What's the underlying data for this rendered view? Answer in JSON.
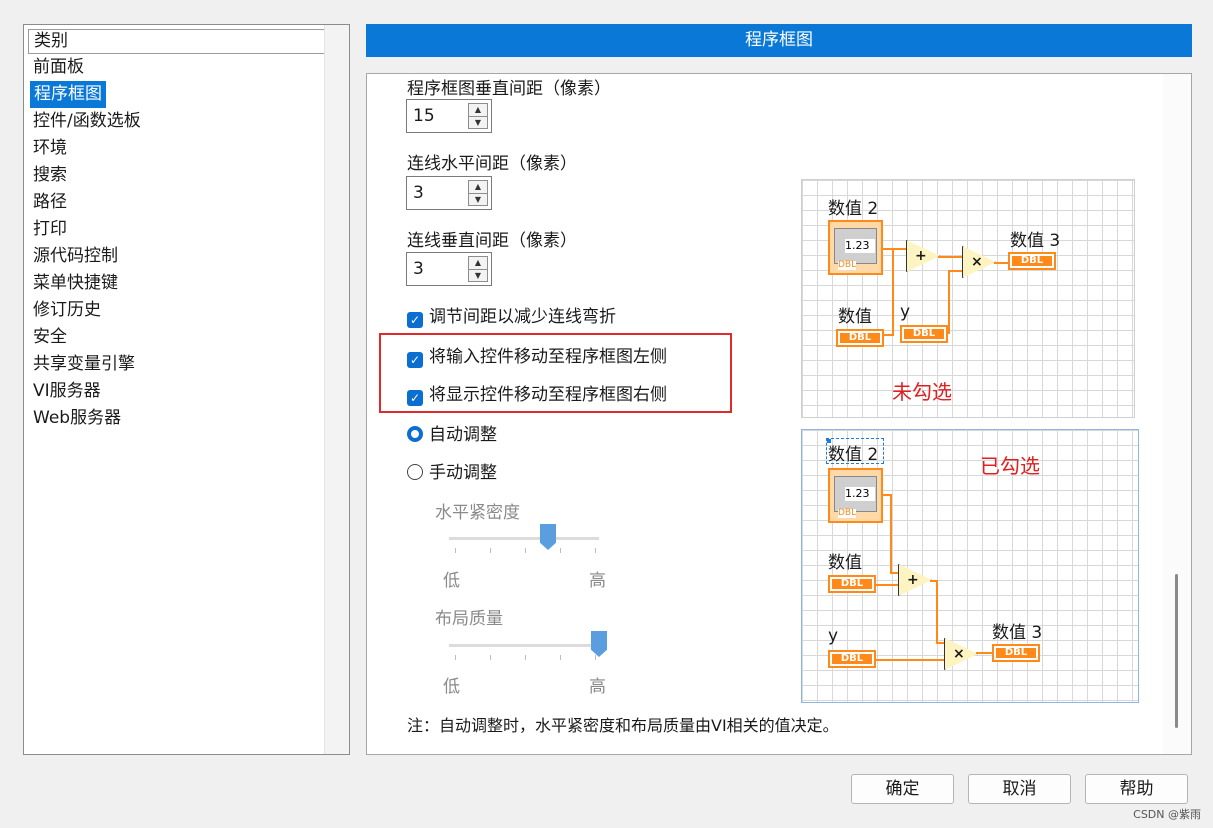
{
  "categories": {
    "header": "类别",
    "items": [
      "前面板",
      "程序框图",
      "控件/函数选板",
      "环境",
      "搜索",
      "路径",
      "打印",
      "源代码控制",
      "菜单快捷键",
      "修订历史",
      "安全",
      "共享变量引擎",
      "VI服务器",
      "Web服务器"
    ],
    "selected": "程序框图"
  },
  "panel_title": "程序框图",
  "settings": {
    "top_label": "程序框图垂直间距（像素）",
    "spin1_value": "15",
    "wire_h_label": "连线水平间距（像素）",
    "spin2_value": "3",
    "wire_v_label": "连线垂直间距（像素）",
    "spin3_value": "3",
    "adjust_spacing": {
      "label": "调节间距以减少连线弯折",
      "checked": true
    },
    "move_inputs_left": {
      "label": "将输入控件移动至程序框图左侧",
      "checked": true
    },
    "move_outputs_right": {
      "label": "将显示控件移动至程序框图右侧",
      "checked": true
    },
    "auto_adjust": {
      "label": "自动调整",
      "selected": true
    },
    "manual_adjust": {
      "label": "手动调整",
      "selected": false
    },
    "h_density": {
      "label": "水平紧密度",
      "low": "低",
      "high": "高",
      "value_fraction": 0.66
    },
    "layout_quality": {
      "label": "布局质量",
      "low": "低",
      "high": "高",
      "value_fraction": 1.0
    },
    "note": "注：自动调整时，水平紧密度和布局质量由VI相关的值决定。"
  },
  "diagrams": {
    "unchecked": {
      "caption": "未勾选",
      "num2": "数值 2",
      "num": "数值",
      "y": "y",
      "num3": "数值 3",
      "ctl_value": "1.23",
      "dbl": "DBL",
      "plus": "+",
      "times": "×"
    },
    "checked": {
      "caption": "已勾选",
      "num2": "数值 2",
      "num": "数值",
      "y": "y",
      "num3": "数值 3",
      "ctl_value": "1.23",
      "dbl": "DBL",
      "plus": "+",
      "times": "×"
    }
  },
  "buttons": {
    "ok": "确定",
    "cancel": "取消",
    "help": "帮助"
  },
  "watermark": "CSDN @紫雨",
  "colors": {
    "accent": "#0a78d7",
    "wire": "#ff8a1a",
    "highlight": "#e12a2a"
  }
}
